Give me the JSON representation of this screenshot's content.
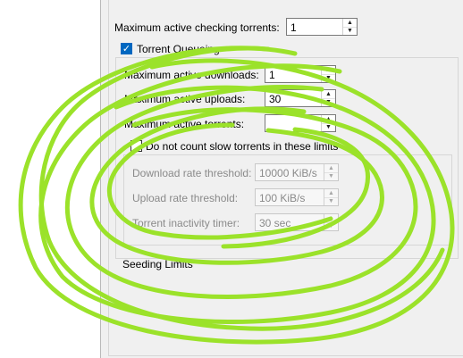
{
  "settings": {
    "max_checking": {
      "label": "Maximum active checking torrents:",
      "value": "1"
    },
    "torrent_queueing": {
      "label": "Torrent Queueing",
      "checked": true
    },
    "max_downloads": {
      "label": "Maximum active downloads:",
      "value": "1"
    },
    "max_uploads": {
      "label": "Maximum active uploads:",
      "value": "30"
    },
    "max_torrents": {
      "label": "Maximum active torrents:",
      "value": ""
    },
    "slow_torrents": {
      "label": "Do not count slow torrents in these limits",
      "checked": false
    },
    "download_threshold": {
      "label": "Download rate threshold:",
      "value": "10000 KiB/s"
    },
    "upload_threshold": {
      "label": "Upload rate threshold:",
      "value": "100 KiB/s"
    },
    "inactivity_timer": {
      "label": "Torrent inactivity timer:",
      "value": "30 sec"
    },
    "seeding_limits": {
      "label": "Seeding Limits"
    }
  },
  "colors": {
    "scribble": "#9be22a",
    "accent": "#0067c0"
  }
}
